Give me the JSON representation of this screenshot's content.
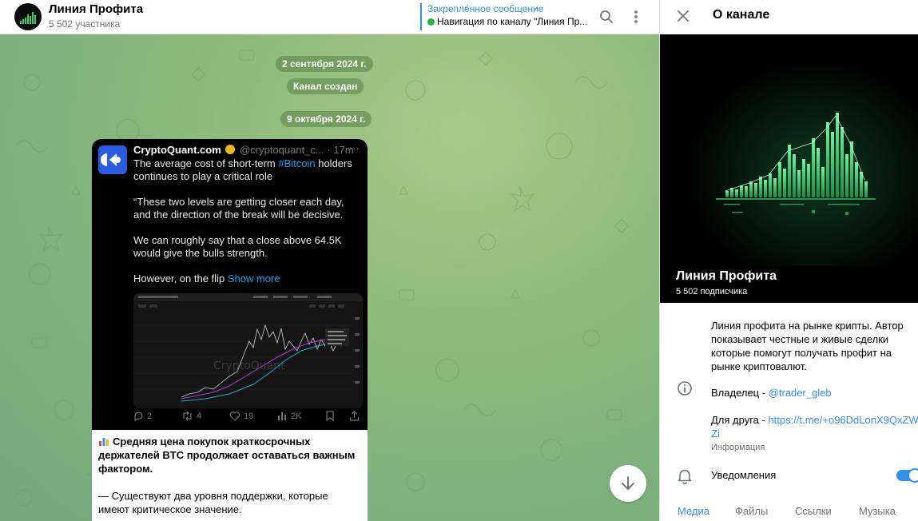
{
  "chat": {
    "title": "Линия Профита",
    "subtitle": "5 502 участника",
    "pinned": {
      "title": "Закреплённое сообщение",
      "text": "Навигация по каналу \"Линия Пр..."
    },
    "service": {
      "date1": "2 сентября 2024 г.",
      "created": "Канал создан",
      "date2": "9 октября 2024 г."
    },
    "tweet": {
      "author": "CryptoQuant.com",
      "handle": "@cryptoquant_c...",
      "time": "· 17m",
      "more": "···",
      "line1_pre": "The average cost of short-term ",
      "line1_tag": "#Bitcoin",
      "line1_post": " holders continues to play a critical role",
      "para2": "“These two levels are getting closer each day, and the direction of the break will be decisive.",
      "para3": "We can roughly say that a close above 64.5K would give the bulls strength.",
      "para4_pre": "However, on the flip ",
      "para4_link": "Show more",
      "watermark": "CryptoQuant",
      "actions": {
        "replies": "2",
        "reposts": "4",
        "likes": "19",
        "views": "2K"
      }
    },
    "message": {
      "headline": "Средняя цена покупок краткосрочных держателей BTC продолжает оставаться важным фактором.",
      "para2": "— Существуют два уровня поддержки, которые имеют критическое значение."
    }
  },
  "info": {
    "title": "О канале",
    "channel_name": "Линия Профита",
    "subscribers": "5 502 подписчика",
    "description": "Линия профита на рынке крипты. Автор показывает честные и живые сделки которые помогут получать профит на рынке криптовалют.",
    "owner_label": "Владелец - ",
    "owner_link": "@trader_gleb",
    "friend_label": "Для друга - ",
    "friend_link": "https://t.me/+o96DdLonX9QxZWZi",
    "caption": "Информация",
    "notifications": "Уведомления",
    "notifications_on": true,
    "tabs": [
      "Медиа",
      "Файлы",
      "Ссылки",
      "Музыка"
    ],
    "active_tab": "Медиа"
  },
  "colors": {
    "accent": "#3390ec",
    "online": "#26b145",
    "tweet_link": "#1d9bf0",
    "banner_green": "#36d173"
  }
}
